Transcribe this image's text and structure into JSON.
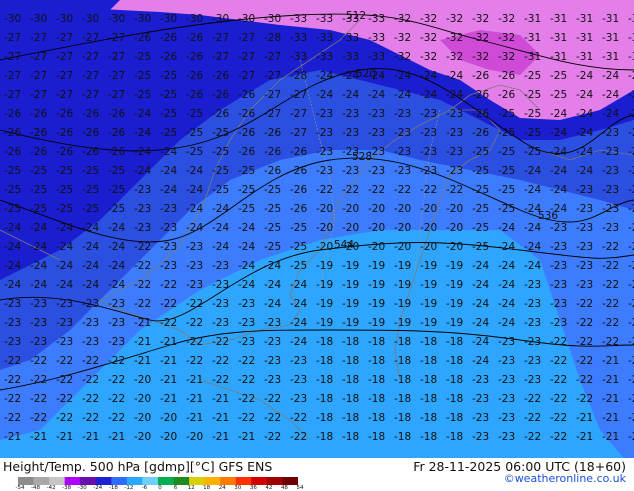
{
  "title": "Height/Temp. 500 hPa [gdmp][°C] GFS ENS",
  "valid_time": "Fr 28-11-2025 06:00 UTC (18+60)",
  "credit": "©weatheronline.co.uk",
  "legend": {
    "labels": [
      "-54",
      "-48",
      "-42",
      "-38",
      "-30",
      "-24",
      "-18",
      "-12",
      "-6",
      "0",
      "6",
      "12",
      "18",
      "24",
      "30",
      "36",
      "42",
      "48",
      "54"
    ],
    "colors": [
      "#8c8c8c",
      "#a9a9a9",
      "#c6c6c6",
      "#b000ff",
      "#6a0dad",
      "#1f1fd6",
      "#2f6bff",
      "#2aa8ff",
      "#6ed0ff",
      "#00b050",
      "#1f8a1f",
      "#d8d000",
      "#ffb000",
      "#ff7a00",
      "#ff3000",
      "#d00000",
      "#a00000",
      "#700000"
    ]
  },
  "isolines": [
    {
      "value": "-31",
      "color": "pink"
    },
    {
      "value": "-32",
      "color": "pink"
    },
    {
      "value": "-33",
      "color": "pink"
    },
    {
      "value": "-34",
      "color": "pink"
    },
    {
      "value": "-30",
      "color": "blue"
    },
    {
      "value": "-29",
      "color": "blue"
    },
    {
      "value": "-28",
      "color": "blue"
    },
    {
      "value": "-27",
      "color": "blue"
    },
    {
      "value": "-26",
      "color": "blue"
    },
    {
      "value": "-25",
      "color": "blue"
    },
    {
      "value": "-24",
      "color": "blue"
    },
    {
      "value": "-23",
      "color": "blue"
    },
    {
      "value": "-22",
      "color": "blue"
    },
    {
      "value": "-21",
      "color": "blue"
    },
    {
      "value": "-20",
      "color": "blue"
    },
    {
      "value": "-19",
      "color": "blue"
    },
    {
      "value": "-18",
      "color": "blue"
    }
  ],
  "height_labels": [
    "512",
    "520",
    "528",
    "536",
    "544"
  ]
}
